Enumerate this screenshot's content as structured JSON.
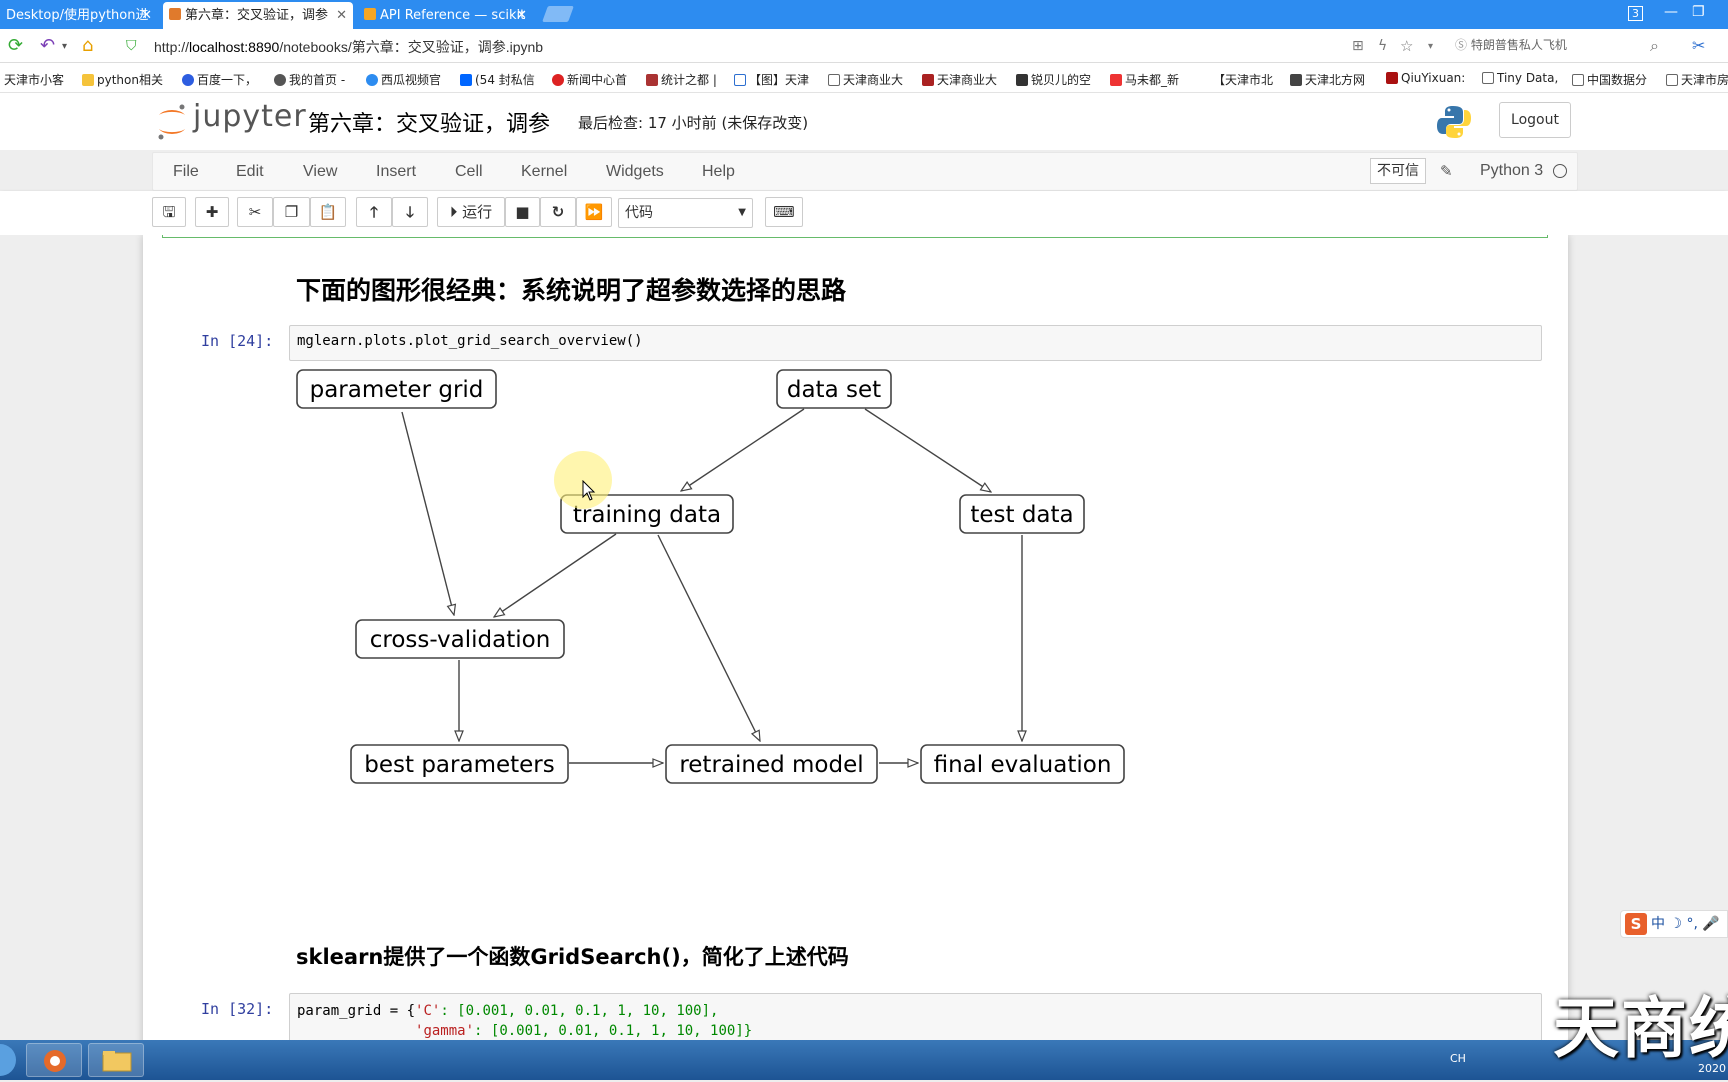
{
  "browser": {
    "tabs": [
      {
        "label": "Desktop/使用python进",
        "active": false
      },
      {
        "label": "第六章：交叉验证，调参",
        "active": true
      },
      {
        "label": "API Reference — scikit",
        "active": false
      }
    ],
    "window_badge": "3",
    "url_prefix": "http://",
    "url_host": "localhost:8890",
    "url_path": "/notebooks/第六章：交叉验证，调参.ipynb",
    "search_placeholder": "特朗普售私人飞机",
    "bookmarks": [
      "天津市小客",
      "python相关",
      "百度一下，",
      "我的首页 -",
      "西瓜视频官",
      "(54 封私信",
      "新闻中心首",
      "统计之都 |",
      "【图】天津",
      "天津商业大",
      "天津商业大",
      "锐贝儿的空",
      "马未都_新",
      "【天津市北",
      "天津北方网",
      "QiuYixuan:",
      "Tiny Data,",
      "中国数据分",
      "天津市房"
    ]
  },
  "jupyter": {
    "logo_text": "jupyter",
    "notebook_title": "第六章：交叉验证，调参",
    "checkpoint": "最后检查: 17 小时前   (未保存改变)",
    "logout_label": "Logout",
    "menu": [
      "File",
      "Edit",
      "View",
      "Insert",
      "Cell",
      "Kernel",
      "Widgets",
      "Help"
    ],
    "trust_label": "不可信",
    "kernel_name": "Python 3",
    "toolbar": {
      "run_label": "运行",
      "cell_type": "代码"
    }
  },
  "notebook": {
    "heading1": "下面的图形很经典：系统说明了超参数选择的思路",
    "cell24": {
      "prompt": "In  [24]:",
      "code": "mglearn.plots.plot_grid_search_overview()"
    },
    "diagram": {
      "nodes": {
        "parameter_grid": "parameter grid",
        "data_set": "data set",
        "training_data": "training data",
        "test_data": "test data",
        "cross_validation": "cross-validation",
        "best_parameters": "best parameters",
        "retrained_model": "retrained model",
        "final_evaluation": "final evaluation"
      }
    },
    "heading2": "sklearn提供了一个函数GridSearch()，简化了上述代码",
    "cell32": {
      "prompt": "In  [32]:",
      "line1_var": "param_grid = {",
      "line1_key": "'C'",
      "line1_vals": ": [0.001, 0.01, 0.1, 1, 10, 100],",
      "line2_indent": "              ",
      "line2_key": "'gamma'",
      "line2_vals": ": [0.001, 0.01, 0.1, 1, 10, 100]}"
    }
  },
  "taskbar": {
    "tray_lang": "CH",
    "clock": "2020"
  },
  "overlay": {
    "ime_text": "中 ☽ °, 🎤",
    "watermark": "天商统"
  }
}
